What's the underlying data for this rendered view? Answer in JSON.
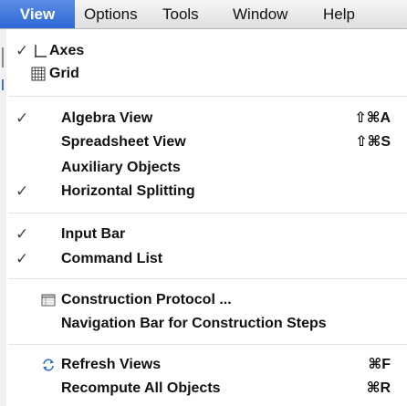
{
  "menubar": {
    "items": [
      "View",
      "Options",
      "Tools",
      "Window",
      "Help"
    ]
  },
  "view_menu": {
    "axes": {
      "label": "Axes",
      "checked": "✓"
    },
    "grid": {
      "label": "Grid"
    },
    "algebra_view": {
      "label": "Algebra View",
      "checked": "✓",
      "shortcut": "⇧⌘A"
    },
    "spreadsheet_view": {
      "label": "Spreadsheet View",
      "shortcut": "⇧⌘S"
    },
    "auxiliary_objects": {
      "label": "Auxiliary Objects"
    },
    "horizontal_splitting": {
      "label": "Horizontal Splitting",
      "checked": "✓"
    },
    "input_bar": {
      "label": "Input Bar",
      "checked": "✓"
    },
    "command_list": {
      "label": "Command List",
      "checked": "✓"
    },
    "construction_protocol": {
      "label": "Construction Protocol ..."
    },
    "navigation_bar": {
      "label": "Navigation Bar for Construction Steps"
    },
    "refresh_views": {
      "label": "Refresh Views",
      "shortcut": "⌘F"
    },
    "recompute_all": {
      "label": "Recompute All Objects",
      "shortcut": "⌘R"
    }
  }
}
